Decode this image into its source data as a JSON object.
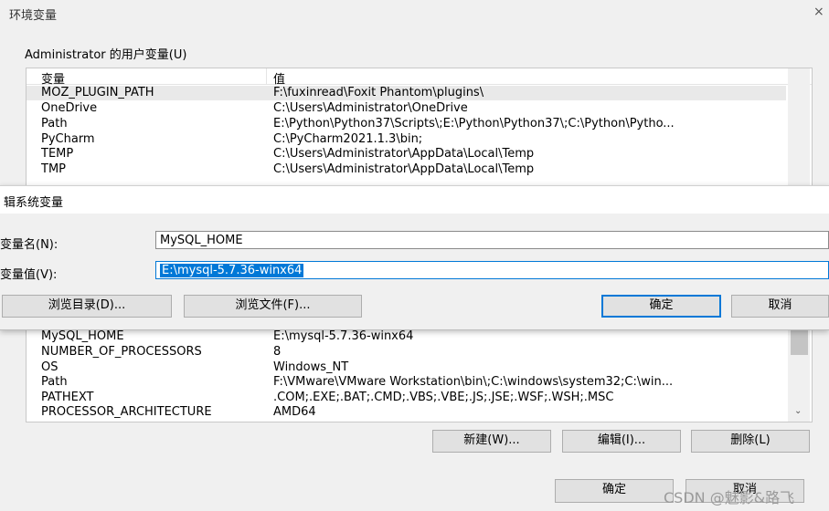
{
  "window": {
    "title": "环境变量",
    "close_glyph": "×"
  },
  "user_vars": {
    "group_label": "Administrator 的用户变量(U)",
    "headers": {
      "name": "变量",
      "value": "值"
    },
    "rows": [
      {
        "name": "MOZ_PLUGIN_PATH",
        "value": "F:\\fuxinread\\Foxit Phantom\\plugins\\"
      },
      {
        "name": "OneDrive",
        "value": "C:\\Users\\Administrator\\OneDrive"
      },
      {
        "name": "Path",
        "value": "E:\\Python\\Python37\\Scripts\\;E:\\Python\\Python37\\;C:\\Python\\Pytho..."
      },
      {
        "name": "PyCharm",
        "value": "C:\\PyCharm2021.1.3\\bin;"
      },
      {
        "name": "TEMP",
        "value": "C:\\Users\\Administrator\\AppData\\Local\\Temp"
      },
      {
        "name": "TMP",
        "value": "C:\\Users\\Administrator\\AppData\\Local\\Temp"
      }
    ]
  },
  "edit_dialog": {
    "title": "辑系统变量",
    "name_label": "变量名(N):",
    "name_value": "MySQL_HOME",
    "value_label": "变量值(V):",
    "value_value": "E:\\mysql-5.7.36-winx64",
    "browse_dir": "浏览目录(D)...",
    "browse_file": "浏览文件(F)...",
    "ok": "确定",
    "cancel": "取消"
  },
  "system_vars": {
    "rows": [
      {
        "name": "MySQL_HOME",
        "value": "E:\\mysql-5.7.36-winx64"
      },
      {
        "name": "NUMBER_OF_PROCESSORS",
        "value": "8"
      },
      {
        "name": "OS",
        "value": "Windows_NT"
      },
      {
        "name": "Path",
        "value": "F:\\VMware\\VMware Workstation\\bin\\;C:\\windows\\system32;C:\\win..."
      },
      {
        "name": "PATHEXT",
        "value": ".COM;.EXE;.BAT;.CMD;.VBS;.VBE;.JS;.JSE;.WSF;.WSH;.MSC"
      },
      {
        "name": "PROCESSOR_ARCHITECTURE",
        "value": "AMD64"
      }
    ],
    "new_btn": "新建(W)...",
    "edit_btn": "编辑(I)...",
    "delete_btn": "删除(L)"
  },
  "footer": {
    "ok": "确定",
    "cancel": "取消"
  },
  "watermark": "CSDN @魅影&路飞"
}
